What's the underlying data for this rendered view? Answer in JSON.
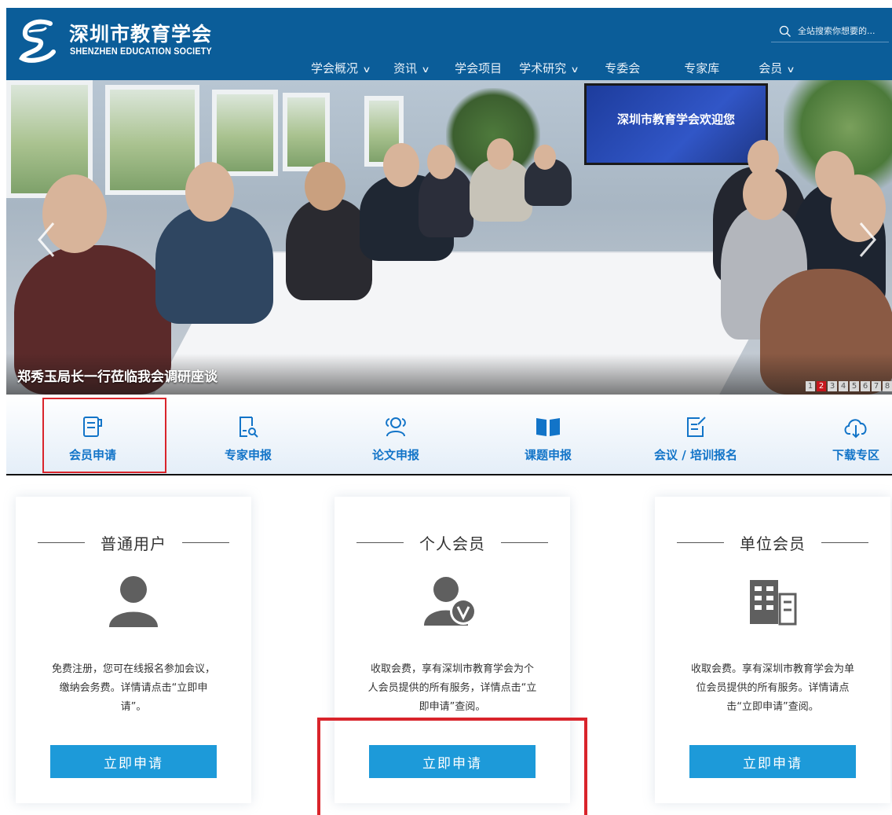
{
  "header": {
    "brand": {
      "name_cn": "深圳市教育学会",
      "name_en": "SHENZHEN EDUCATION SOCIETY",
      "logo_letter": "S"
    },
    "search": {
      "placeholder": "全站搜索你想要的..."
    },
    "nav": [
      {
        "label": "学会概况",
        "has_dropdown": true
      },
      {
        "label": "资讯",
        "has_dropdown": true
      },
      {
        "label": "学会项目",
        "has_dropdown": false
      },
      {
        "label": "学术研究",
        "has_dropdown": true
      },
      {
        "label": "专委会",
        "has_dropdown": false
      },
      {
        "label": "专家库",
        "has_dropdown": false
      },
      {
        "label": "会员",
        "has_dropdown": true
      }
    ],
    "colors": {
      "bar": "#0b5d99"
    }
  },
  "banner": {
    "caption": "郑秀玉局长一行莅临我会调研座谈",
    "screen_text": "深圳市教育学会欢迎您",
    "pages": [
      "1",
      "2",
      "3",
      "4",
      "5",
      "6",
      "7",
      "8"
    ],
    "active_page": "2"
  },
  "quick_links": [
    {
      "label": "会员申请",
      "icon": "document-icon"
    },
    {
      "label": "专家申报",
      "icon": "doc-search-icon"
    },
    {
      "label": "论文申报",
      "icon": "users-icon"
    },
    {
      "label": "课题申报",
      "icon": "open-book-icon"
    },
    {
      "label": "会议 / 培训报名",
      "icon": "edit-doc-icon"
    },
    {
      "label": "下载专区",
      "icon": "cloud-download-icon"
    }
  ],
  "cards": [
    {
      "title": "普通用户",
      "icon": "user-icon",
      "description": "免费注册，您可在线报名参加会议，缴纳会务费。详情请点击“立即申请”。",
      "button": "立即申请"
    },
    {
      "title": "个人会员",
      "icon": "verified-user-icon",
      "description": "收取会费，享有深圳市教育学会为个人会员提供的所有服务，详情点击“立即申请”查阅。",
      "button": "立即申请"
    },
    {
      "title": "单位会员",
      "icon": "building-icon",
      "description": "收取会费。享有深圳市教育学会为单位会员提供的所有服务。详情请点击“立即申请”查阅。",
      "button": "立即申请"
    }
  ],
  "colors": {
    "accent": "#1d9ad9",
    "link": "#1274c8",
    "highlight": "#d9242b"
  }
}
